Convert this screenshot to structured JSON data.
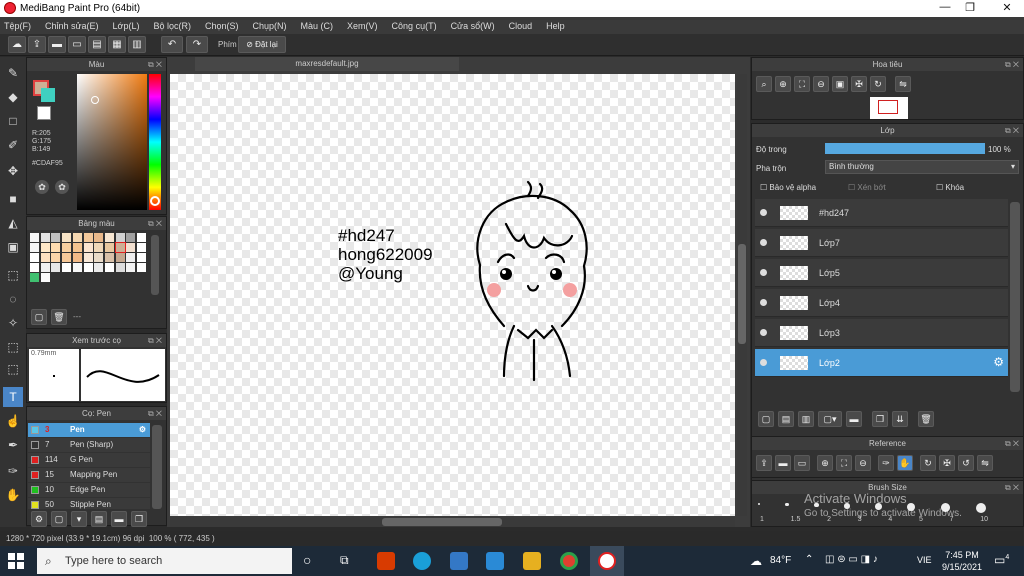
{
  "window": {
    "title": "MediBang Paint Pro (64bit)",
    "minimize": "—",
    "maximize": "❐",
    "close": "✕"
  },
  "menu": [
    "Tệp(F)",
    "Chỉnh sửa(E)",
    "Lớp(L)",
    "Bộ lọc(R)",
    "Chọn(S)",
    "Chụp(N)",
    "Màu (C)",
    "Xem(V)",
    "Công cụ(T)",
    "Cửa sổ(W)",
    "Cloud",
    "Help"
  ],
  "toolbar": {
    "phim_label": "Phím",
    "reset_label": "Đặt lại"
  },
  "color_panel": {
    "title": "Màu",
    "r": "R:205",
    "g": "G:175",
    "b": "B:149",
    "hex": "#CDAF95",
    "primary": "#CDAF95",
    "secondary": "#3fd0c0"
  },
  "palette_panel": {
    "title": "Bảng màu",
    "footer": "---"
  },
  "brush_preview": {
    "title": "Xem trước cọ",
    "size": "0.79mm"
  },
  "brush_panel": {
    "title": "Cọ: Pen",
    "items": [
      {
        "size": "3",
        "name": "Pen",
        "color": "#5bc8e8"
      },
      {
        "size": "7",
        "name": "Pen (Sharp)",
        "color": "#333333"
      },
      {
        "size": "114",
        "name": "G Pen",
        "color": "#e02020"
      },
      {
        "size": "15",
        "name": "Mapping Pen",
        "color": "#e02020"
      },
      {
        "size": "10",
        "name": "Edge Pen",
        "color": "#20c020"
      },
      {
        "size": "50",
        "name": "Stipple Pen",
        "color": "#e0e020"
      }
    ]
  },
  "document": {
    "tab": "maxresdefault.jpg",
    "line1": "#hd247",
    "line2": "hong622009",
    "line3": "@Young"
  },
  "navigator": {
    "title": "Hoa tiêu"
  },
  "layer_panel": {
    "title": "Lớp",
    "opacity_label": "Độ trong",
    "opacity_value": "100 %",
    "opacity": 1.0,
    "blend_label": "Pha trộn",
    "blend_value": "Bình thường",
    "protect_alpha": "Bảo vệ alpha",
    "clipping": "Xén bớt",
    "lock": "Khóa",
    "layers": [
      "#hd247",
      "Lớp7",
      "Lớp5",
      "Lớp4",
      "Lớp3",
      "Lớp2"
    ]
  },
  "reference_panel": {
    "title": "Reference"
  },
  "brush_size_panel": {
    "title": "Brush Size",
    "sizes": [
      "1",
      "1.5",
      "2",
      "3",
      "4",
      "5",
      "7",
      "10"
    ]
  },
  "watermark": {
    "line1": "Activate Windows",
    "line2": "Go to Settings to activate Windows."
  },
  "status": {
    "size": "1280 * 720 pixel",
    "cm": "(33.9 * 19.1cm)",
    "dpi": "96 dpi",
    "zoom": "100 %",
    "coords": "( 772, 435 )"
  },
  "taskbar": {
    "search": "Type here to search",
    "temp": "84°F",
    "lang": "VIE",
    "time": "7:45 PM",
    "date": "9/15/2021",
    "notif": "4"
  }
}
